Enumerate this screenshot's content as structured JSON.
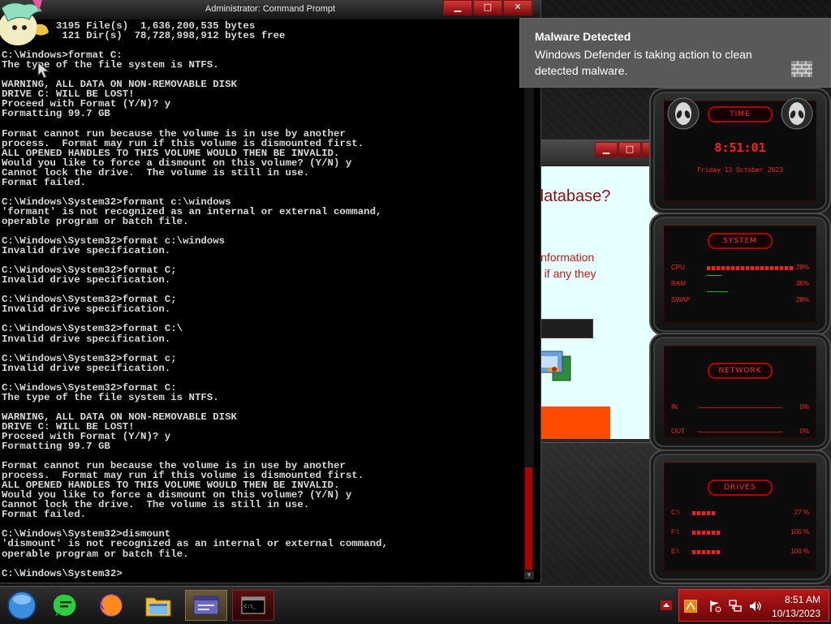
{
  "cmd": {
    "title": "Administrator: Command Prompt",
    "buttons": {
      "minimize": "▁",
      "maximize": "□",
      "close": "✕"
    },
    "output": "         3195 File(s)  1,636,200,535 bytes\n          121 Dir(s)  78,728,998,912 bytes free\n\nC:\\Windows>format C:\nThe type of the file system is NTFS.\n\nWARNING, ALL DATA ON NON-REMOVABLE DISK\nDRIVE C: WILL BE LOST!\nProceed with Format (Y/N)? y\nFormatting 99.7 GB\n\nFormat cannot run because the volume is in use by another\nprocess.  Format may run if this volume is dismounted first.\nALL OPENED HANDLES TO THIS VOLUME WOULD THEN BE INVALID.\nWould you like to force a dismount on this volume? (Y/N) y\nCannot lock the drive.  The volume is still in use.\nFormat failed.\n\nC:\\Windows\\System32>formant c:\\windows\n'formant' is not recognized as an internal or external command,\noperable program or batch file.\n\nC:\\Windows\\System32>format c:\\windows\nInvalid drive specification.\n\nC:\\Windows\\System32>format C;\nInvalid drive specification.\n\nC:\\Windows\\System32>format C;\nInvalid drive specification.\n\nC:\\Windows\\System32>format C:\\\nInvalid drive specification.\n\nC:\\Windows\\System32>format c;\nInvalid drive specification.\n\nC:\\Windows\\System32>format C:\nThe type of the file system is NTFS.\n\nWARNING, ALL DATA ON NON-REMOVABLE DISK\nDRIVE C: WILL BE LOST!\nProceed with Format (Y/N)? y\nFormatting 99.7 GB\n\nFormat cannot run because the volume is in use by another\nprocess.  Format may run if this volume is dismounted first.\nALL OPENED HANDLES TO THIS VOLUME WOULD THEN BE INVALID.\nWould you like to force a dismount on this volume? (Y/N) y\nCannot lock the drive.  The volume is still in use.\nFormat failed.\n\nC:\\Windows\\System32>dismount\n'dismount' is not recognized as an internal or external command,\noperable program or batch file.\n\nC:\\Windows\\System32>"
  },
  "dialog": {
    "question": "database?",
    "info_line1": "information",
    "info_line2": "e if any they"
  },
  "toast": {
    "title": "Malware Detected",
    "message": "Windows Defender is taking action to clean detected malware."
  },
  "gadget": {
    "time_title": "TIME",
    "time": "8:51:01",
    "date": "Friday 13 October 2023",
    "system_title": "SYSTEM",
    "cpu_label": "CPU",
    "cpu_value": "28%",
    "cpu_level": 0.28,
    "ram_label": "RAM",
    "ram_value": "36%",
    "swap_label": "SWAP",
    "swap_value": "28%",
    "network_title": "NETWORK",
    "in_label": "IN",
    "in_value": "0%",
    "out_label": "OUT",
    "out_value": "0%",
    "drives_title": "DRIVES",
    "drive_c_label": "C:\\",
    "drive_c_value": "27 %",
    "drive_f_label": "F:\\",
    "drive_f_value": "100 %",
    "drive_e_label": "E:\\",
    "drive_e_value": "100 %"
  },
  "tray": {
    "time": "8:51 AM",
    "date": "10/13/2023"
  },
  "colors": {
    "accent_red": "#ff1e1e",
    "toast_bg": "#595959",
    "orange_button": "#ff4b00"
  }
}
